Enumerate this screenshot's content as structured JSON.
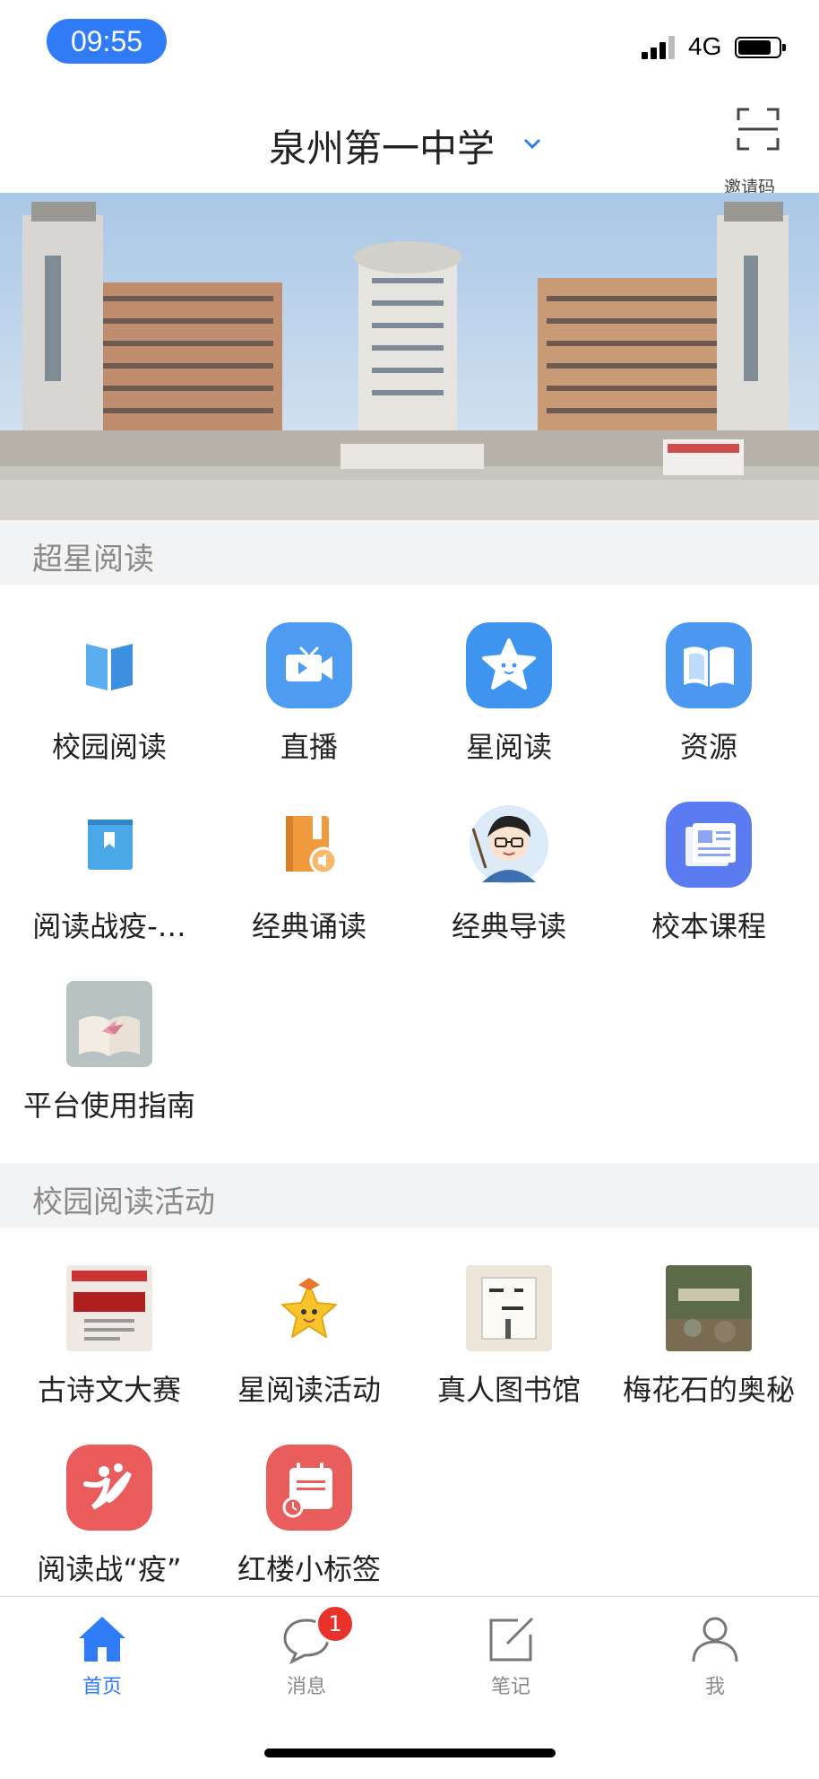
{
  "status_bar": {
    "time": "09:55",
    "network": "4G"
  },
  "header": {
    "school_name": "泉州第一中学",
    "invite_label": "邀请码"
  },
  "sections": {
    "reading": {
      "title": "超星阅读",
      "items": [
        {
          "label": "校园阅读",
          "icon": "open-book-icon"
        },
        {
          "label": "直播",
          "icon": "tv-icon"
        },
        {
          "label": "星阅读",
          "icon": "star-icon"
        },
        {
          "label": "资源",
          "icon": "book-icon"
        },
        {
          "label": "阅读战疫-…",
          "icon": "bookmark-book-icon"
        },
        {
          "label": "经典诵读",
          "icon": "audio-book-icon"
        },
        {
          "label": "经典导读",
          "icon": "teacher-avatar-icon"
        },
        {
          "label": "校本课程",
          "icon": "newspaper-icon"
        },
        {
          "label": "平台使用指南",
          "icon": "guide-thumbnail"
        }
      ]
    },
    "activities": {
      "title": "校园阅读活动",
      "items": [
        {
          "label": "古诗文大赛",
          "icon": "poster-thumbnail"
        },
        {
          "label": "星阅读活动",
          "icon": "star-mascot-icon"
        },
        {
          "label": "真人图书馆",
          "icon": "living-library-thumbnail"
        },
        {
          "label": "梅花石的奥秘",
          "icon": "plum-stone-thumbnail"
        },
        {
          "label": "阅读战“疫”",
          "icon": "people-icon"
        },
        {
          "label": "红楼小标签",
          "icon": "calendar-note-icon"
        }
      ]
    }
  },
  "tabs": [
    {
      "label": "首页",
      "icon": "home-icon",
      "active": true
    },
    {
      "label": "消息",
      "icon": "message-icon",
      "badge": "1"
    },
    {
      "label": "笔记",
      "icon": "note-edit-icon"
    },
    {
      "label": "我",
      "icon": "person-icon"
    }
  ],
  "colors": {
    "accent": "#2f7cf6",
    "badge": "#e8332d",
    "section_bg": "#f2f3f5"
  }
}
